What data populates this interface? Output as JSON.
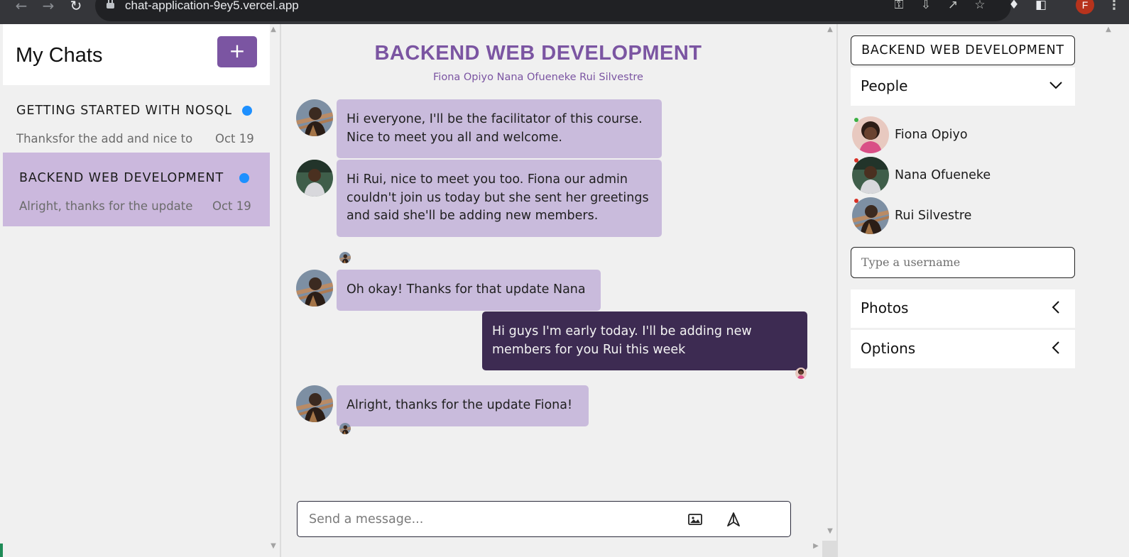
{
  "browser": {
    "url": "chat-application-9ey5.vercel.app",
    "profile_initial": "F",
    "icons": [
      "back-icon",
      "forward-icon",
      "reload-icon",
      "lock-icon",
      "key-icon",
      "install-icon",
      "share-icon",
      "star-icon",
      "extensions-icon",
      "sidepanel-icon",
      "menu-icon"
    ]
  },
  "sidebar": {
    "title": "My Chats",
    "add_label": "+",
    "chats": [
      {
        "title": "GETTING STARTED WITH NOSQL D",
        "preview": "Thanksfor the add and nice to r",
        "date": "Oct 19",
        "unread": true,
        "active": false
      },
      {
        "title": "BACKEND WEB DEVELOPMENT",
        "preview": "Alright, thanks for the update I",
        "date": "Oct 19",
        "unread": true,
        "active": true
      }
    ]
  },
  "feed": {
    "title": "BACKEND WEB DEVELOPMENT",
    "subtitle": "Fiona Opiyo Nana Ofueneke Rui Silvestre",
    "messages": [
      {
        "sender": "Rui Silvestre",
        "mine": false,
        "text": "Hi everyone, I'll be the facilitator of this course. Nice to meet you all and welcome."
      },
      {
        "sender": "Nana Ofueneke",
        "mine": false,
        "text": "Hi Rui, nice to meet you too. Fiona our admin couldn't join us today but she sent her greetings and said she'll be adding new members."
      },
      {
        "sender": "Rui Silvestre",
        "mine": false,
        "text": "Oh okay! Thanks for that update Nana"
      },
      {
        "sender": "Fiona Opiyo",
        "mine": true,
        "text": "Hi guys I'm early today. I'll be adding new members for you Rui this week"
      },
      {
        "sender": "Rui Silvestre",
        "mine": false,
        "text": "Alright, thanks for the update Fiona!"
      }
    ],
    "input_placeholder": "Send a message..."
  },
  "settings": {
    "title": "BACKEND WEB DEVELOPMENT",
    "people_label": "People",
    "people": [
      {
        "name": "Fiona Opiyo",
        "online": true
      },
      {
        "name": "Nana Ofueneke",
        "online": false
      },
      {
        "name": "Rui Silvestre",
        "online": false
      }
    ],
    "username_placeholder": "Type a username",
    "photos_label": "Photos",
    "options_label": "Options"
  },
  "colors": {
    "accent": "#7b55a2",
    "bubble": "#c9bbdc",
    "my_bubble": "#3d2b52",
    "active_chat": "#cbb8dd",
    "unread_dot": "#1e90ff",
    "online": "#3cb043",
    "offline": "#d93025"
  }
}
